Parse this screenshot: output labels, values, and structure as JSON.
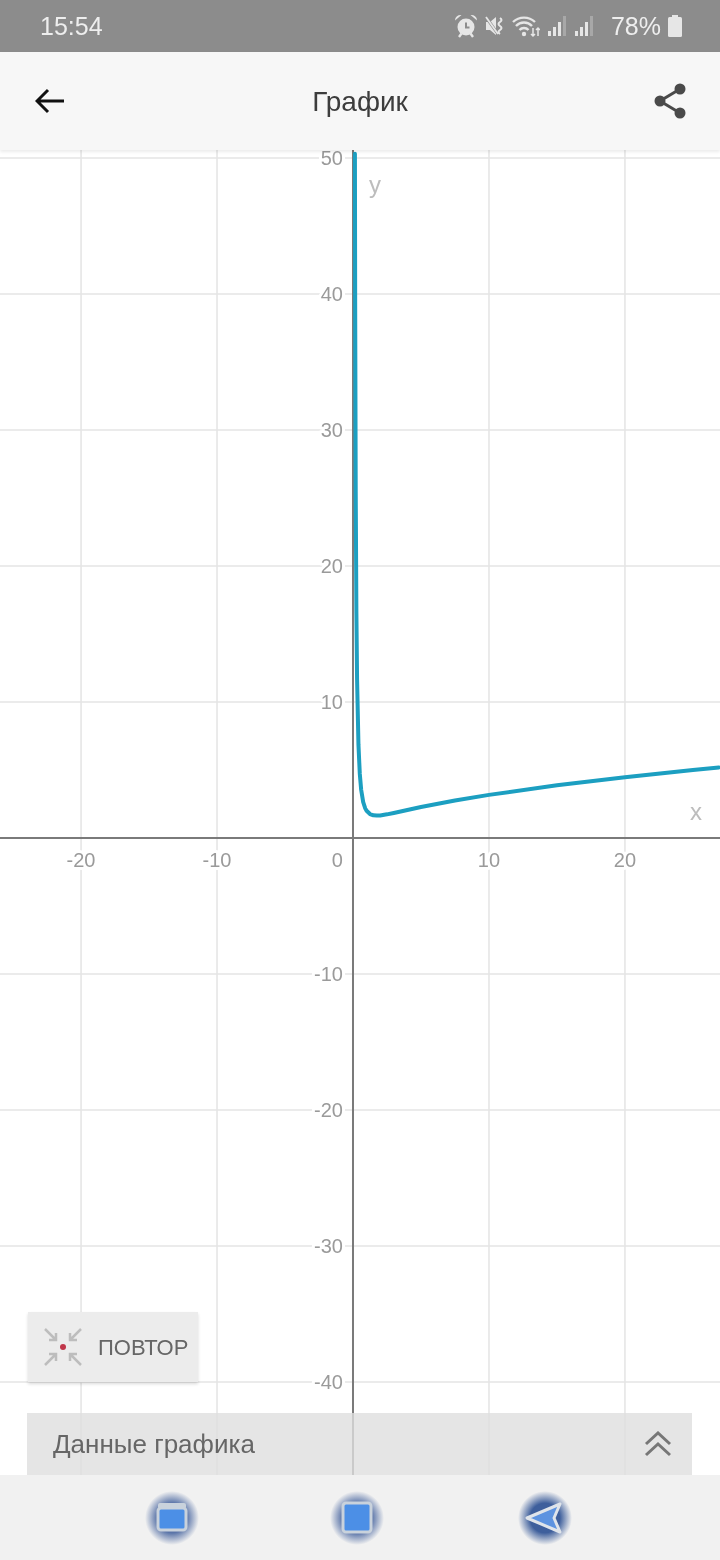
{
  "status_bar": {
    "time": "15:54",
    "battery": "78%"
  },
  "header": {
    "title": "График"
  },
  "graph": {
    "chart_data": {
      "type": "line",
      "xlabel": "x",
      "ylabel": "y",
      "x": [
        0.1415,
        0.16,
        0.2,
        0.25,
        0.3,
        0.4,
        0.5,
        0.6,
        0.75,
        0.9,
        1,
        1.25,
        1.5,
        1.75,
        2,
        2.5,
        3,
        4,
        5,
        7.5,
        10,
        15,
        20,
        25,
        26.9
      ],
      "series": [
        {
          "color": "#1c9fc1",
          "values": [
            50.32,
            39.46,
            25.45,
            16.5,
            11.66,
            6.88,
            4.71,
            3.55,
            2.64,
            2.18,
            2,
            1.76,
            1.67,
            1.65,
            1.66,
            1.74,
            1.84,
            2.06,
            2.28,
            2.76,
            3.17,
            3.88,
            4.47,
            5,
            5.19
          ]
        }
      ],
      "xlim": [
        -25.96,
        26.99
      ],
      "ylim": [
        -46.84,
        50.59
      ],
      "xticks": [
        -20,
        -10,
        10,
        20
      ],
      "yticks": [
        -40,
        -30,
        -20,
        -10,
        10,
        20,
        30,
        40,
        50
      ],
      "grid": true
    },
    "origin_label": "0"
  },
  "reset_button": {
    "label": "ПОВТОР"
  },
  "data_panel": {
    "label": "Данные графика",
    "expanded": false
  }
}
